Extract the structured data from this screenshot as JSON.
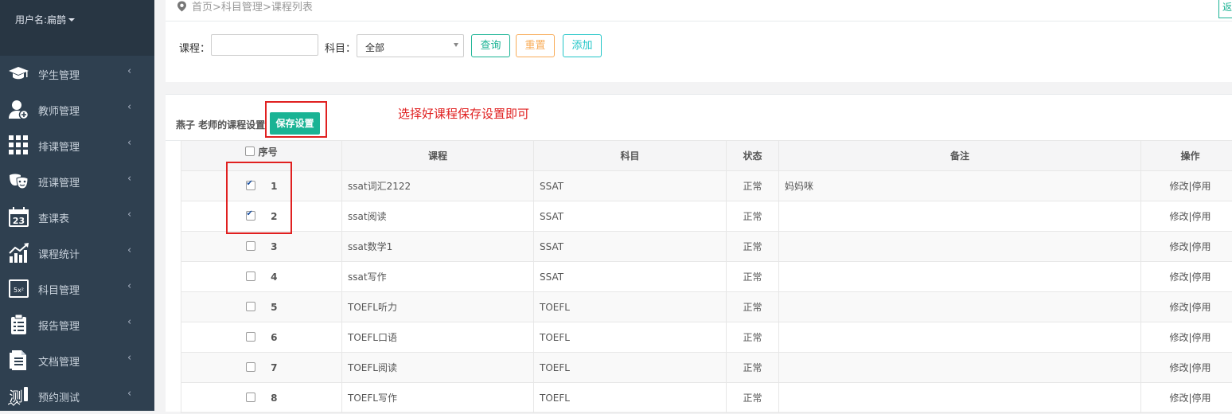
{
  "sidebar": {
    "user_label": "用户名:扁鹊",
    "items": [
      {
        "label": "学生管理",
        "icon": "graduation-cap-icon"
      },
      {
        "label": "教师管理",
        "icon": "user-plus-icon"
      },
      {
        "label": "排课管理",
        "icon": "grid-icon"
      },
      {
        "label": "班课管理",
        "icon": "theater-masks-icon"
      },
      {
        "label": "查课表",
        "icon": "calendar-23-icon"
      },
      {
        "label": "课程统计",
        "icon": "bar-chart-trend-icon"
      },
      {
        "label": "科目管理",
        "icon": "math-board-icon"
      },
      {
        "label": "报告管理",
        "icon": "clipboard-icon"
      },
      {
        "label": "文档管理",
        "icon": "document-icon"
      },
      {
        "label": "预约测试",
        "icon": "test-icon"
      }
    ],
    "arrow": "‹",
    "test_icon_glyph": "测"
  },
  "breadcrumb": {
    "home": "首页",
    "sep": ">",
    "subject": "科目管理",
    "current": "课程列表",
    "return_label": "返"
  },
  "search": {
    "course_label": "课程：",
    "course_value": "",
    "subject_label": "科目：",
    "subject_value": "全部",
    "query_label": "查询",
    "reset_label": "重置",
    "add_label": "添加"
  },
  "panel": {
    "title": "燕子 老师的课程设置",
    "save_label": "保存设置",
    "hint": "选择好课程保存设置即可"
  },
  "table": {
    "headers": {
      "index": "序号",
      "course": "课程",
      "subject": "科目",
      "status": "状态",
      "note": "备注",
      "ops": "操作"
    },
    "rows": [
      {
        "index": "1",
        "checked": true,
        "course": "ssat词汇2122",
        "subject": "SSAT",
        "status": "正常",
        "note": "妈妈咪",
        "edit": "修改",
        "sep": "|",
        "disable": "停用"
      },
      {
        "index": "2",
        "checked": true,
        "course": "ssat阅读",
        "subject": "SSAT",
        "status": "正常",
        "note": "",
        "edit": "修改",
        "sep": "|",
        "disable": "停用"
      },
      {
        "index": "3",
        "checked": false,
        "course": "ssat数学1",
        "subject": "SSAT",
        "status": "正常",
        "note": "",
        "edit": "修改",
        "sep": "|",
        "disable": "停用"
      },
      {
        "index": "4",
        "checked": false,
        "course": "ssat写作",
        "subject": "SSAT",
        "status": "正常",
        "note": "",
        "edit": "修改",
        "sep": "|",
        "disable": "停用"
      },
      {
        "index": "5",
        "checked": false,
        "course": "TOEFL听力",
        "subject": "TOEFL",
        "status": "正常",
        "note": "",
        "edit": "修改",
        "sep": "|",
        "disable": "停用"
      },
      {
        "index": "6",
        "checked": false,
        "course": "TOEFL口语",
        "subject": "TOEFL",
        "status": "正常",
        "note": "",
        "edit": "修改",
        "sep": "|",
        "disable": "停用"
      },
      {
        "index": "7",
        "checked": false,
        "course": "TOEFL阅读",
        "subject": "TOEFL",
        "status": "正常",
        "note": "",
        "edit": "修改",
        "sep": "|",
        "disable": "停用"
      },
      {
        "index": "8",
        "checked": false,
        "course": "TOEFL写作",
        "subject": "TOEFL",
        "status": "正常",
        "note": "",
        "edit": "修改",
        "sep": "|",
        "disable": "停用"
      }
    ]
  },
  "colors": {
    "sidebar_bg": "#2f4050",
    "primary": "#1ab394",
    "warning": "#f8ac59",
    "info": "#23c6c8",
    "annotation": "#e02020"
  }
}
